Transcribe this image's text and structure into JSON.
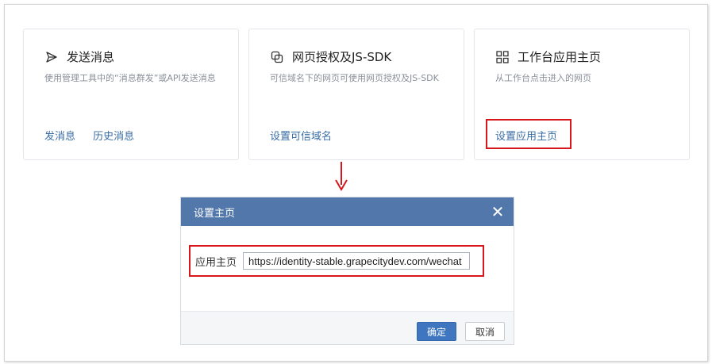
{
  "cards": [
    {
      "title": "发送消息",
      "icon": "send-icon",
      "description": "使用管理工具中的“消息群发”或API发送消息",
      "links": [
        "发消息",
        "历史消息"
      ]
    },
    {
      "title": "网页授权及JS-SDK",
      "icon": "web-auth-icon",
      "description": "可信域名下的网页可使用网页授权及JS-SDK",
      "links": [
        "设置可信域名"
      ]
    },
    {
      "title": "工作台应用主页",
      "icon": "grid-icon",
      "description": "从工作台点击进入的网页",
      "links": [
        "设置应用主页"
      ]
    }
  ],
  "dialog": {
    "title": "设置主页",
    "field_label": "应用主页",
    "field_value": "https://identity-stable.grapecitydev.com/wechat",
    "ok_label": "确定",
    "cancel_label": "取消"
  },
  "colors": {
    "highlight": "#d9161c",
    "dialog_header": "#5277aa",
    "link": "#3a6ea5",
    "primary_button": "#3f76bf"
  }
}
